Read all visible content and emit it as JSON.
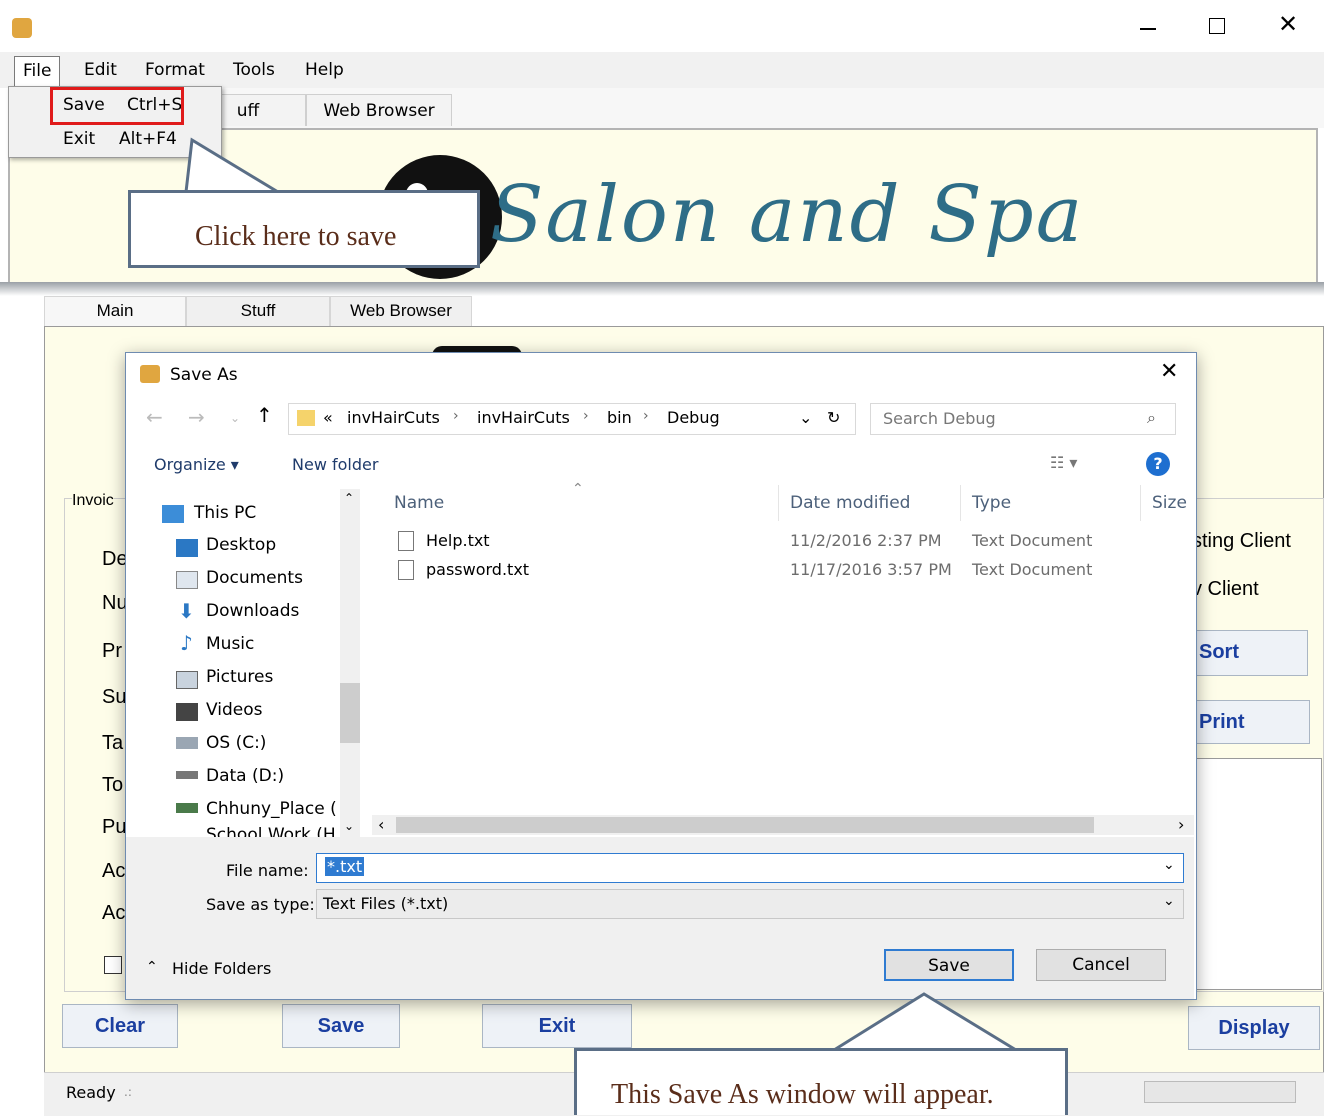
{
  "top_window": {
    "menu": [
      "File",
      "Edit",
      "Format",
      "Tools",
      "Help"
    ],
    "file_menu": [
      {
        "label": "Save",
        "shortcut": "Ctrl+S"
      },
      {
        "label": "Exit",
        "shortcut": "Alt+F4"
      }
    ],
    "tabs": [
      "uff",
      "Web Browser"
    ],
    "banner_title": "Salon and Spa",
    "callout": "Click here to save"
  },
  "app_window": {
    "tabs": [
      "Main",
      "Stuff",
      "Web Browser"
    ],
    "group_label": "Invoic",
    "left_labels": [
      "De",
      "Nu",
      "Pr",
      "Su",
      "Ta",
      "To",
      "Pu",
      "Ac",
      "Ac"
    ],
    "right_labels": [
      "sting Client",
      "v Client"
    ],
    "right_buttons": [
      "Sort",
      "Print"
    ],
    "bottom_buttons": [
      "Clear",
      "Save",
      "Exit",
      "Display"
    ],
    "status": "Ready"
  },
  "dialog": {
    "title": "Save As",
    "breadcrumb": [
      "«",
      "invHairCuts",
      "invHairCuts",
      "bin",
      "Debug"
    ],
    "search_placeholder": "Search Debug",
    "organize": "Organize ▾",
    "new_folder": "New folder",
    "nav_items": [
      "This PC",
      "Desktop",
      "Documents",
      "Downloads",
      "Music",
      "Pictures",
      "Videos",
      "OS (C:)",
      "Data (D:)",
      "Chhuny_Place (E",
      "School Work (H"
    ],
    "columns": [
      "Name",
      "Date modified",
      "Type",
      "Size"
    ],
    "files": [
      {
        "name": "Help.txt",
        "date": "11/2/2016 2:37 PM",
        "type": "Text Document"
      },
      {
        "name": "password.txt",
        "date": "11/17/2016 3:57 PM",
        "type": "Text Document"
      }
    ],
    "file_name_label": "File name:",
    "file_name_value": "*.txt",
    "save_type_label": "Save as type:",
    "save_type_value": "Text Files (*.txt)",
    "hide_folders": "Hide Folders",
    "save_button": "Save",
    "cancel_button": "Cancel"
  },
  "callout2": "This Save As window will appear."
}
